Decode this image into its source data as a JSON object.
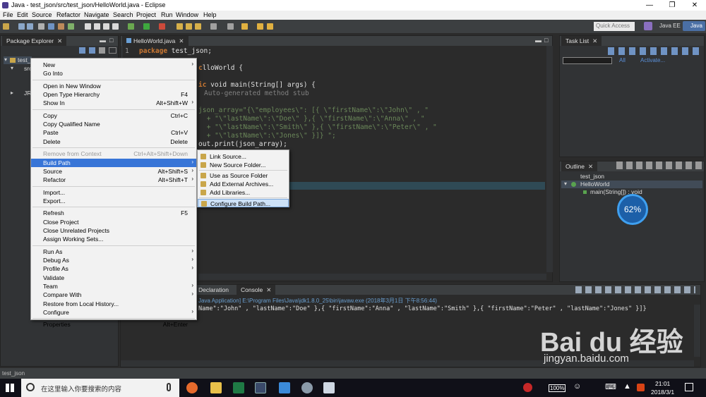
{
  "window": {
    "title": "Java - test_json/src/test_json/HelloWorld.java - Eclipse",
    "min": "—",
    "max": "❐",
    "close": "✕"
  },
  "menubar": [
    "File",
    "Edit",
    "Source",
    "Refactor",
    "Navigate",
    "Search",
    "Project",
    "Run",
    "Window",
    "Help"
  ],
  "toolbar": {
    "quick_access": "Quick Access",
    "perspective_1": "Java EE",
    "perspective_2": "Java"
  },
  "package_explorer": {
    "tab": "Package Explorer",
    "tree": [
      "test_json",
      "src",
      "JR"
    ]
  },
  "editor": {
    "tab": "HelloWorld.java",
    "lines": [
      {
        "n": "1",
        "kw": "package",
        "rest": " test_json;"
      },
      {
        "n": "",
        "kw": "",
        "rest": "lloWorld {"
      },
      {
        "n": "",
        "kw": "ic",
        "rest": " void main(String[] args) {"
      },
      {
        "n": "",
        "kw": "",
        "rest": "Auto-generated method stub"
      },
      {
        "n": "",
        "kw": "",
        "rest": "json_array=\"{\\\"employees\\\": [{ \\\"firstName\\\":\\\"John\\\" , \""
      },
      {
        "n": "",
        "kw": "",
        "rest": " + \"\\\"lastName\\\":\\\"Doe\\\" },{ \\\"firstName\\\":\\\"Anna\\\" , \""
      },
      {
        "n": "",
        "kw": "",
        "rest": " + \"\\\"lastName\\\":\\\"Smith\\\" },{ \\\"firstName\\\":\\\"Peter\\\" , \""
      },
      {
        "n": "",
        "kw": "",
        "rest": " + \"\\\"lastName\\\":\\\"Jones\\\" }]} \";"
      },
      {
        "n": "",
        "kw": "",
        "rest": "out.print(json_array);"
      }
    ]
  },
  "task_list": {
    "tab": "Task List",
    "all": "All",
    "activate": "Activate..."
  },
  "outline": {
    "tab": "Outline",
    "items": [
      "test_json",
      "HelloWorld",
      "main(String[]) : void"
    ]
  },
  "badge": "62%",
  "console": {
    "tab_declaration": "Declaration",
    "tab_console": "Console",
    "header": "Java Application] E:\\Program Files\\Java\\jdk1.8.0_25\\bin\\javaw.exe (2018年3月1日 下午8:56:44)",
    "output": "Name\":\"John\" , \"lastName\":\"Doe\" },{ \"firstName\":\"Anna\" , \"lastName\":\"Smith\" },{ \"firstName\":\"Peter\" , \"lastName\":\"Jones\" }]}"
  },
  "status": "test_json",
  "context_menu": [
    {
      "label": "New",
      "sc": "",
      "arrow": true
    },
    {
      "label": "Go Into",
      "sc": ""
    },
    {
      "sep": true
    },
    {
      "label": "Open in New Window",
      "sc": ""
    },
    {
      "label": "Open Type Hierarchy",
      "sc": "F4"
    },
    {
      "label": "Show In",
      "sc": "Alt+Shift+W",
      "arrow": true
    },
    {
      "sep": true
    },
    {
      "label": "Copy",
      "sc": "Ctrl+C"
    },
    {
      "label": "Copy Qualified Name",
      "sc": ""
    },
    {
      "label": "Paste",
      "sc": "Ctrl+V"
    },
    {
      "label": "Delete",
      "sc": "Delete"
    },
    {
      "sep": true
    },
    {
      "label": "Remove from Context",
      "sc": "Ctrl+Alt+Shift+Down",
      "disabled": true
    },
    {
      "label": "Build Path",
      "sc": "",
      "arrow": true,
      "highlight": true
    },
    {
      "label": "Source",
      "sc": "Alt+Shift+S",
      "arrow": true
    },
    {
      "label": "Refactor",
      "sc": "Alt+Shift+T",
      "arrow": true
    },
    {
      "sep": true
    },
    {
      "label": "Import...",
      "sc": ""
    },
    {
      "label": "Export...",
      "sc": ""
    },
    {
      "sep": true
    },
    {
      "label": "Refresh",
      "sc": "F5"
    },
    {
      "label": "Close Project",
      "sc": ""
    },
    {
      "label": "Close Unrelated Projects",
      "sc": ""
    },
    {
      "label": "Assign Working Sets...",
      "sc": ""
    },
    {
      "sep": true
    },
    {
      "label": "Run As",
      "sc": "",
      "arrow": true
    },
    {
      "label": "Debug As",
      "sc": "",
      "arrow": true
    },
    {
      "label": "Profile As",
      "sc": "",
      "arrow": true
    },
    {
      "label": "Validate",
      "sc": ""
    },
    {
      "label": "Team",
      "sc": "",
      "arrow": true
    },
    {
      "label": "Compare With",
      "sc": "",
      "arrow": true
    },
    {
      "label": "Restore from Local History...",
      "sc": ""
    },
    {
      "label": "Configure",
      "sc": "",
      "arrow": true
    },
    {
      "sep": true
    },
    {
      "label": "Properties",
      "sc": "Alt+Enter"
    }
  ],
  "submenu": [
    {
      "label": "Link Source..."
    },
    {
      "label": "New Source Folder..."
    },
    {
      "sep": true
    },
    {
      "label": "Use as Source Folder"
    },
    {
      "label": "Add External Archives..."
    },
    {
      "label": "Add Libraries..."
    },
    {
      "sep": true
    },
    {
      "label": "Configure Build Path...",
      "highlight": true
    }
  ],
  "taskbar": {
    "search_placeholder": "在这里输入你要搜索的内容",
    "time": "21:01",
    "date": "2018/3/1",
    "battery": "100%"
  },
  "watermark": {
    "brand": "Bai du 经验",
    "url": "jingyan.baidu.com"
  }
}
